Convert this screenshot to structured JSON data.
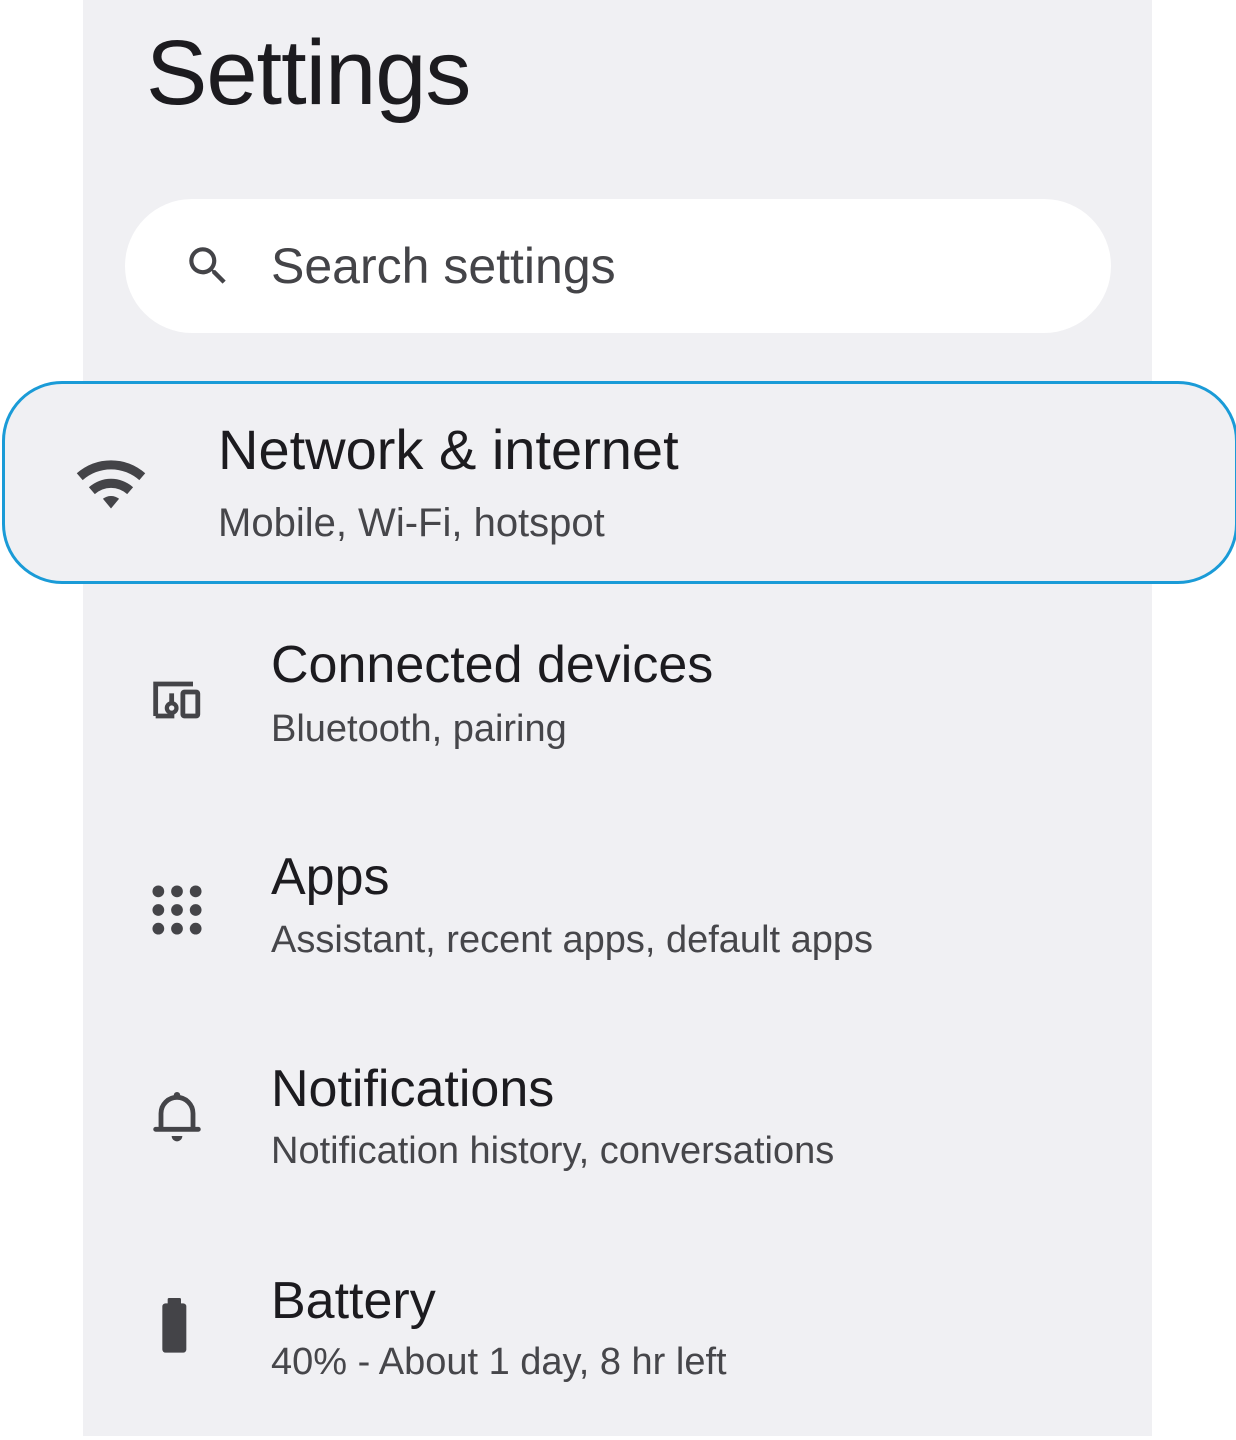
{
  "page": {
    "title": "Settings"
  },
  "search": {
    "placeholder": "Search settings",
    "icon": "search-icon"
  },
  "items": [
    {
      "icon": "wifi-icon",
      "title": "Network & internet",
      "subtitle": "Mobile, Wi-Fi, hotspot",
      "highlighted": true
    },
    {
      "icon": "devices-icon",
      "title": "Connected devices",
      "subtitle": "Bluetooth, pairing"
    },
    {
      "icon": "apps-grid-icon",
      "title": "Apps",
      "subtitle": "Assistant, recent apps, default apps"
    },
    {
      "icon": "bell-icon",
      "title": "Notifications",
      "subtitle": "Notification history, conversations"
    },
    {
      "icon": "battery-icon",
      "title": "Battery",
      "subtitle": "40% - About 1 day, 8 hr left"
    }
  ],
  "colors": {
    "background": "#f0f0f3",
    "highlight_border": "#1a9bd7",
    "icon": "#444448",
    "text_primary": "#1c1b1f",
    "text_secondary": "#46464a"
  }
}
